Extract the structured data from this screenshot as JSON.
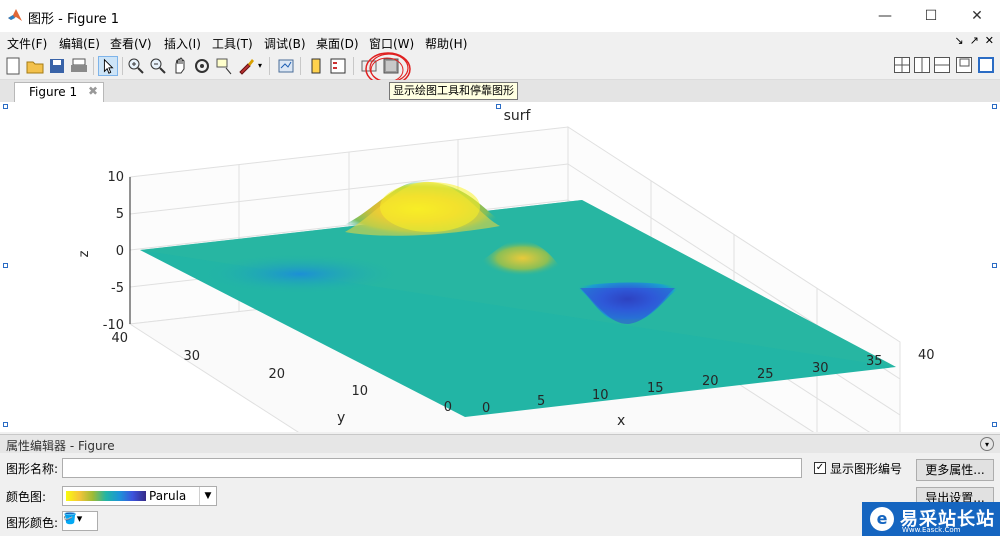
{
  "window": {
    "title": "图形 - Figure 1"
  },
  "menu": [
    "文件(F)",
    "编辑(E)",
    "查看(V)",
    "插入(I)",
    "工具(T)",
    "调试(B)",
    "桌面(D)",
    "窗口(W)",
    "帮助(H)"
  ],
  "tooltip": "显示绘图工具和停靠图形",
  "tab": {
    "label": "Figure 1"
  },
  "plot": {
    "title": "surf",
    "xlabel": "x",
    "ylabel": "y",
    "zlabel": "z",
    "xticks": [
      "0",
      "5",
      "10",
      "15",
      "20",
      "25",
      "30",
      "35",
      "40"
    ],
    "yticks": [
      "0",
      "10",
      "20",
      "30",
      "40"
    ],
    "zticks": [
      "10",
      "5",
      "0",
      "-5",
      "-10"
    ]
  },
  "chart_data": {
    "type": "surface",
    "title": "surf",
    "xlabel": "x",
    "ylabel": "y",
    "zlabel": "z",
    "xlim": [
      0,
      40
    ],
    "ylim": [
      0,
      40
    ],
    "zlim": [
      -10,
      10
    ],
    "colormap": "Parula",
    "features": [
      {
        "kind": "peak",
        "z": 8
      },
      {
        "kind": "peak",
        "z": 3
      },
      {
        "kind": "valley",
        "z": -7
      }
    ]
  },
  "property_editor": {
    "title": "属性编辑器 - Figure",
    "name_label": "图形名称:",
    "name_value": "",
    "colormap_label": "颜色图:",
    "colormap_value": "Parula",
    "color_label": "图形颜色:",
    "show_number_label": "显示图形编号",
    "more_button": "更多属性...",
    "export_button": "导出设置..."
  },
  "watermark": {
    "text": "易采站长站",
    "sub": "Www.Easck.Com"
  },
  "colors": {
    "accent": "#2b6cc4",
    "surface_flat": "#22b5a5",
    "peak": "#f9fb0e",
    "valley": "#3c53dc"
  }
}
